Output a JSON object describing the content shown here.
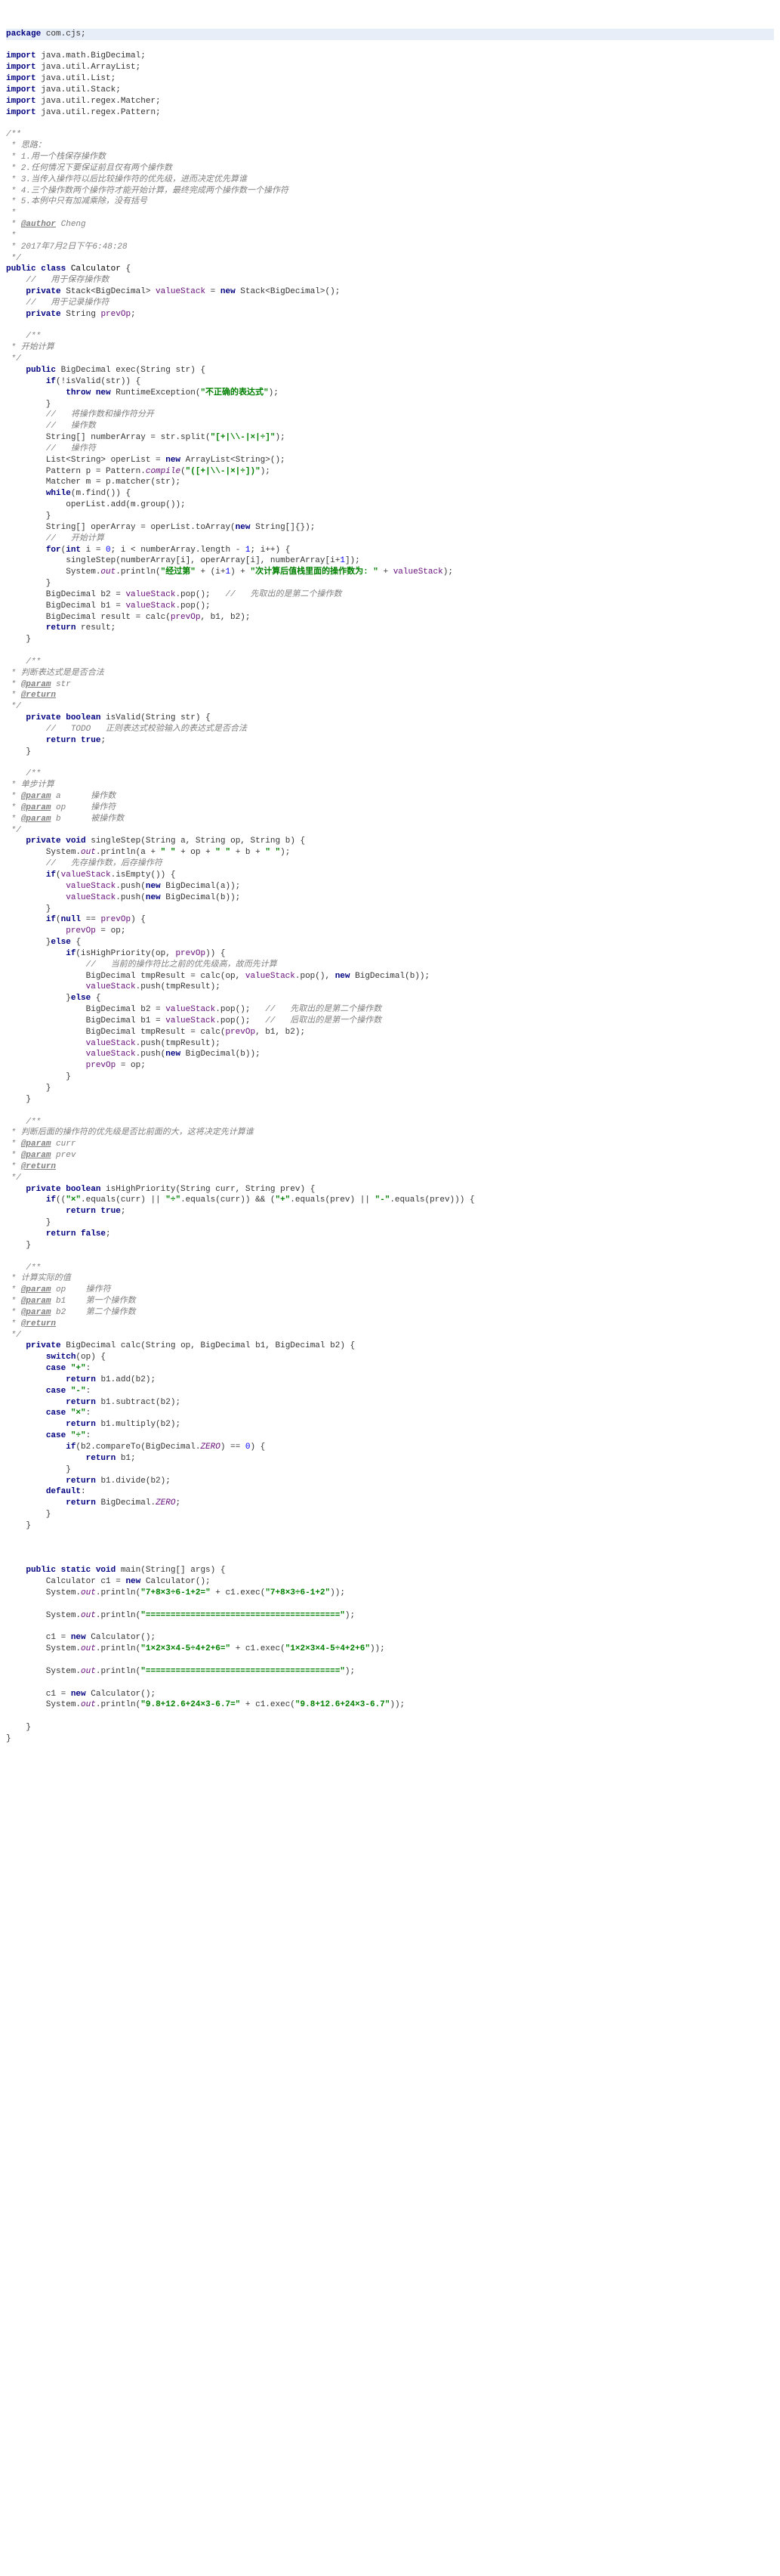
{
  "pkg": "com.cjs;",
  "imp": [
    "java.math.BigDecimal;",
    "java.util.ArrayList;",
    "java.util.List;",
    "java.util.Stack;",
    "java.util.regex.Matcher;",
    "java.util.regex.Pattern;"
  ],
  "c0": "/**",
  "c1": " * 思路：",
  "c2": " * 1.用一个栈保存操作数",
  "c3": " * 2.任何情况下要保证前且仅有两个操作数",
  "c4": " * 3.当传入操作符以后比较操作符的优先级，进而决定优先算谁",
  "c5": " * 4.三个操作数两个操作符才能开始计算，最终完成两个操作数一个操作符",
  "c6": " * 5.本例中只有加减乘除，没有括号",
  "c7": " *",
  "c8": " * @author Cheng",
  "c9": " *",
  "c10": " * 2017年7月2日下午6:48:28",
  "c11": " */",
  "cl": "Calculator",
  "c12": "//   用于保存操作数",
  "c13": "//   用于记录操作符",
  "t_stack": "Stack<BigDecimal>",
  "t_str": "String",
  "fld1": "valueStack",
  "fld2": "prevOp",
  "new_stack": "Stack<BigDecimal>();",
  "d0": "/**",
  "d1": " * 开始计算",
  "d2": " */",
  "m_exec": "exec(String ",
  "p_str": "str",
  "excmsg": "\"不正确的表达式\"",
  "c14": "//   将操作数和操作符分开",
  "c15": "//   操作数",
  "split_re": "\"[+|\\\\-|×|÷]\"",
  "c16": "//   操作符",
  "compile_re": "\"([+|\\\\-|×|÷])\"",
  "m_matcher": "p.matcher(",
  "m_find": "m.find()",
  "m_group": "m.group()",
  "toarr": "operList.toArray(",
  "newstrarr": "String[]{})",
  "c17": "//   开始计算",
  "loop": "numberArray.length",
  "step": "singleStep(numberArray[",
  "step2": "], operArray[",
  "step3": "], numberArray[",
  "out1": "\"经过第\"",
  "out2": "\"次计算后值栈里面的操作数为: \"",
  "c18": "//   先取出的是第二个操作数",
  "d3": "/**",
  "d4": " * 判断表达式是是否合法",
  "d5": " * @param str",
  "d6": " * @return",
  "d7": " */",
  "m_isvalid": "isValid(String ",
  "c19": "//   TODO   正则表达式校验输入的表达式是否合法",
  "d8": "/**",
  "d9": " * 单步计算",
  "d10": " * @param a      操作数",
  "d11": " * @param op     操作符",
  "d12": " * @param b      被操作数",
  "d13": " */",
  "m_single": "singleStep(String ",
  "p_a": "a",
  "p_op": "op",
  "p_b": "b",
  "out_space": "\" \"",
  "c20": "//   先存操作数，后存操作符",
  "c21": "//   当前的操作符比之前的优先级高，故而先计算",
  "c22": "//   先取出的是第二个操作数",
  "c23": "//   后取出的是第一个操作数",
  "d14": "/**",
  "d15": " * 判断后面的操作符的优先级是否比前面的大，这将决定先计算谁",
  "d16": " * @param curr",
  "d17": " * @param prev",
  "d18": " * @return",
  "d19": " */",
  "m_hp": "isHighPriority(String ",
  "p_curr": "curr",
  "p_prev": "prev",
  "s_mul": "\"×\"",
  "s_div": "\"÷\"",
  "s_plus": "\"+\"",
  "s_minus": "\"-\"",
  "d20": "/**",
  "d21": " * 计算实际的值",
  "d22": " * @param op    操作符",
  "d23": " * @param b1    第一个操作数",
  "d24": " * @param b2    第二个操作数",
  "d25": " * @return",
  "d26": " */",
  "m_calc": "calc(String ",
  "p_b1": "b1",
  "p_b2": "b2",
  "cs_p": "\"+\"",
  "cs_m": "\"-\"",
  "cs_x": "\"×\"",
  "cs_d": "\"÷\"",
  "zero": "ZERO",
  "m_main": "main(String[] args)",
  "ex1": "\"7+8×3÷6-1+2=\"",
  "ex1a": "\"7+8×3÷6-1+2\"",
  "sep": "\"=======================================\"",
  "ex2": "\"1×2×3×4-5÷4+2+6=\"",
  "ex2a": "\"1×2×3×4-5÷4+2+6\"",
  "ex3": "\"9.8+12.6+24×3-6.7=\"",
  "ex3a": "\"9.8+12.6+24×3-6.7\""
}
